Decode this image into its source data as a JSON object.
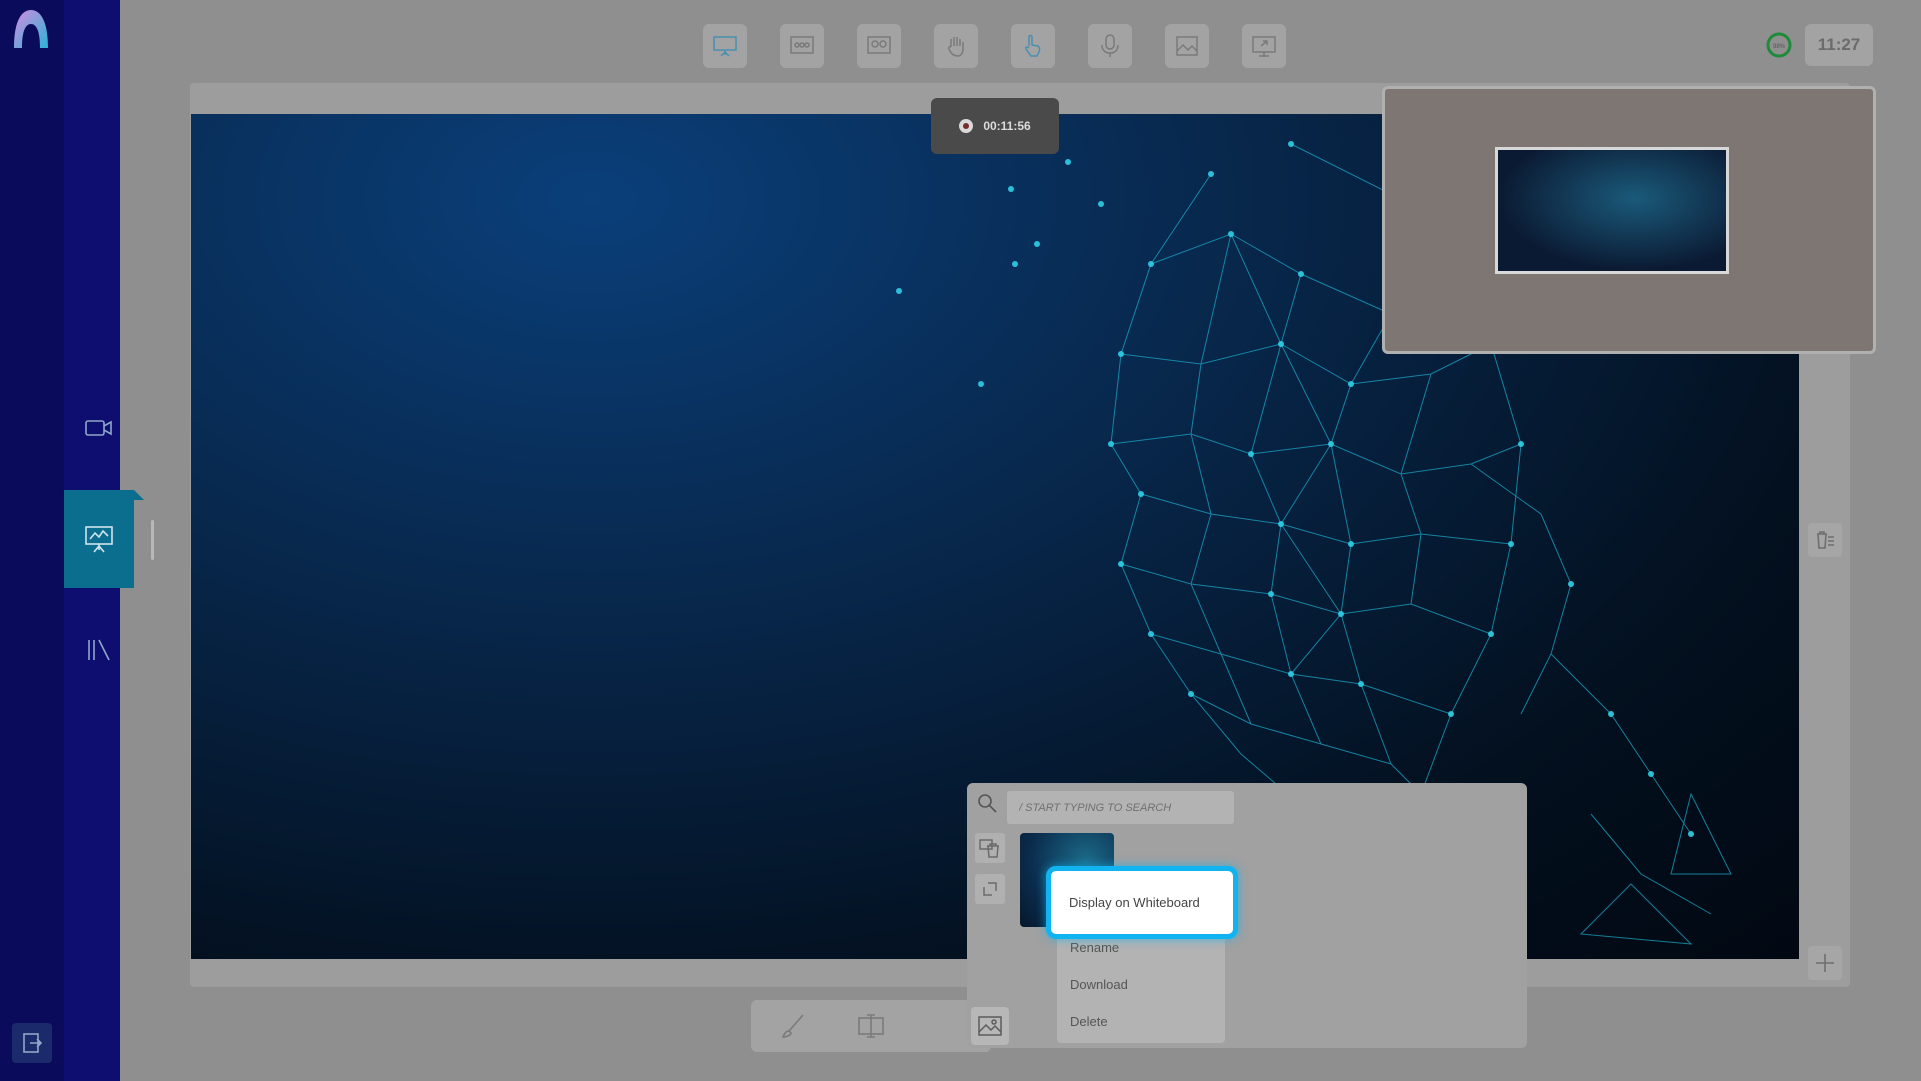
{
  "app": {
    "logo_icon": "app-logo-icon"
  },
  "sidebar": {
    "items": [
      {
        "name": "video",
        "icon": "video-camera-icon",
        "active": false
      },
      {
        "name": "whiteboard",
        "icon": "presentation-board-icon",
        "active": true
      },
      {
        "name": "library",
        "icon": "library-icon",
        "active": false
      }
    ],
    "exit_icon": "exit-icon"
  },
  "toolbar": {
    "tools": [
      {
        "name": "presentation",
        "icon": "presentation-board-icon"
      },
      {
        "name": "class",
        "icon": "group-icon"
      },
      {
        "name": "breakout",
        "icon": "breakout-group-icon"
      },
      {
        "name": "raise-hand",
        "icon": "hand-icon"
      },
      {
        "name": "pointer",
        "icon": "pointer-hand-icon"
      },
      {
        "name": "microphone",
        "icon": "microphone-icon"
      },
      {
        "name": "media",
        "icon": "image-frame-icon"
      },
      {
        "name": "share-screen",
        "icon": "share-screen-icon"
      }
    ],
    "timer_label": "98%",
    "clock": "11:27"
  },
  "recording": {
    "time": "00:11:56"
  },
  "media_panel": {
    "search_placeholder": "/ START TYPING TO SEARCH",
    "context_menu": {
      "highlighted": "Display on Whiteboard",
      "items": [
        "Rename",
        "Download",
        "Delete"
      ]
    }
  },
  "colors": {
    "sidebar": "#0b0b5c",
    "active": "#0b6e8e",
    "highlight": "#11b4f0",
    "overlay": "#8f8f8f"
  }
}
